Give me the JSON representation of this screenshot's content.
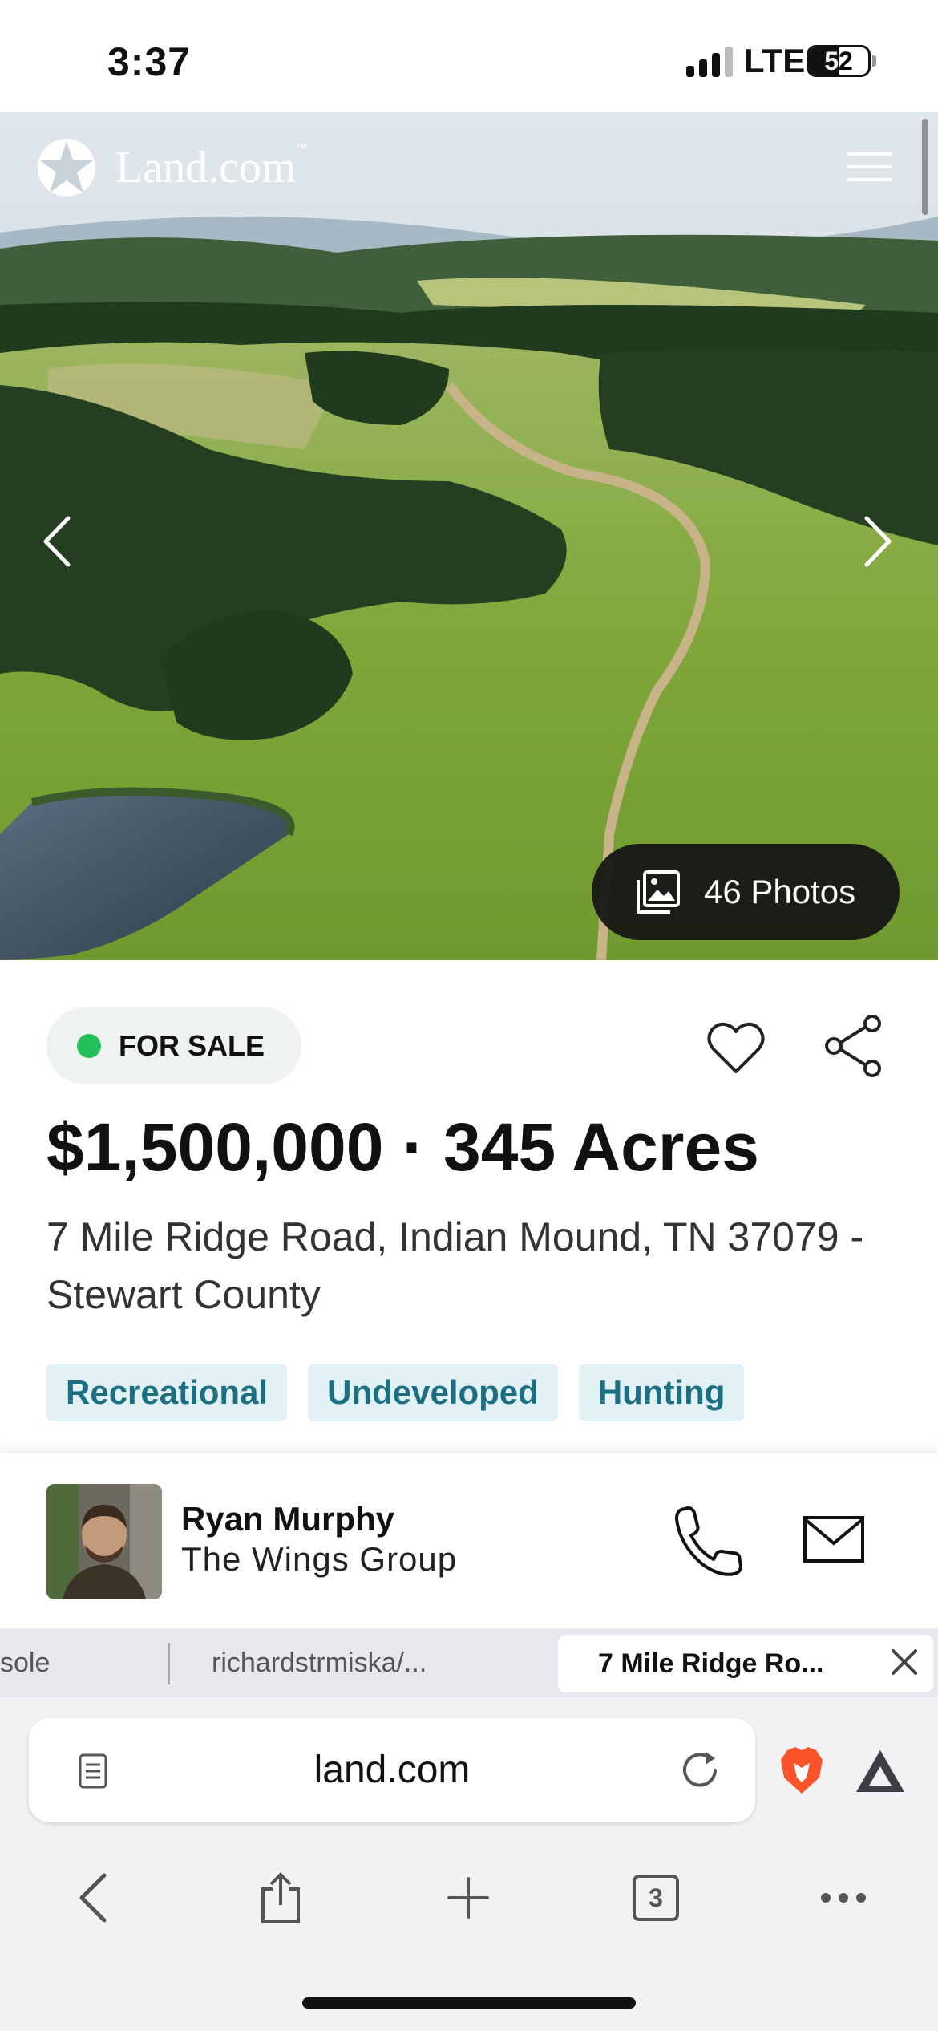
{
  "status_bar": {
    "time": "3:37",
    "network": "LTE",
    "battery_percent": "52",
    "signal_bars_active": 3,
    "signal_bars_total": 4
  },
  "header": {
    "logo_text": "Land.com",
    "logo_tm": "™",
    "menu_icon": "hamburger-menu-icon"
  },
  "gallery": {
    "photos_label": "46 Photos",
    "prev_icon": "chevron-left-icon",
    "next_icon": "chevron-right-icon"
  },
  "listing": {
    "status": "FOR SALE",
    "status_color": "#22c05a",
    "price_line": "$1,500,000 · 345 Acres",
    "address": "7 Mile Ridge Road, Indian Mound, TN 37079 - Stewart County",
    "tags": [
      "Recreational",
      "Undeveloped",
      "Hunting"
    ],
    "favorite_icon": "heart-outline-icon",
    "share_icon": "share-icon"
  },
  "agent": {
    "name": "Ryan Murphy",
    "company": "The Wings Group",
    "call_icon": "phone-icon",
    "email_icon": "mail-icon"
  },
  "browser": {
    "tabs": [
      {
        "label": "sole"
      },
      {
        "label": "richardstrmiska/..."
      },
      {
        "label": "7 Mile Ridge Ro..."
      }
    ],
    "url": "land.com",
    "tab_count": "3",
    "accent_colors": {
      "brave": "#fb542b",
      "rewards": "#3d3d45"
    }
  }
}
